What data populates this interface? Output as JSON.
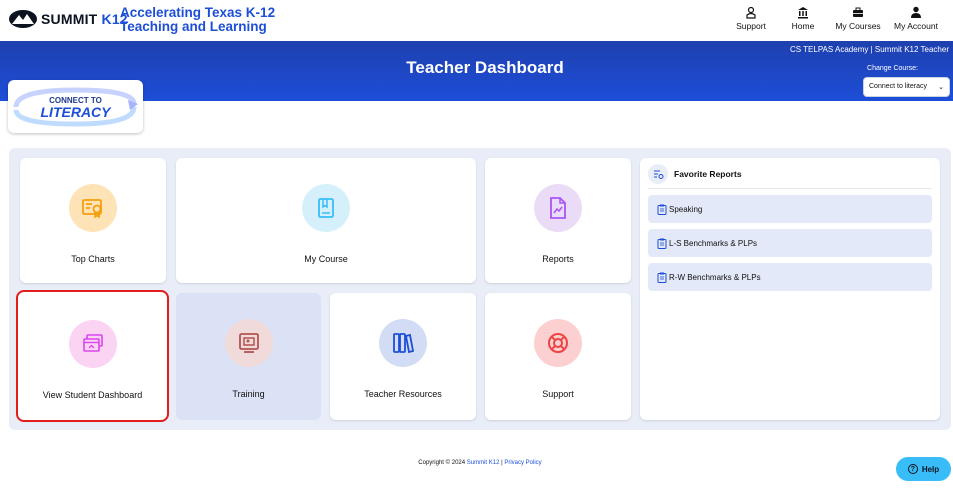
{
  "header": {
    "brand": "SUMMIT",
    "brand_k12": "K12",
    "tagline_line1": "Accelerating Texas K-12",
    "tagline_line2": "Teaching and Learning",
    "nav": [
      {
        "label": "Support",
        "icon": "support-icon"
      },
      {
        "label": "Home",
        "icon": "home-icon"
      },
      {
        "label": "My Courses",
        "icon": "briefcase-icon"
      },
      {
        "label": "My Account",
        "icon": "user-icon"
      }
    ]
  },
  "banner": {
    "title": "Teacher Dashboard",
    "school": "CS TELPAS Academy | Summit K12 Teacher",
    "change_course_label": "Change Course:",
    "selected_course": "Connect to literacy"
  },
  "course_logo": {
    "line1": "CONNECT TO",
    "line2": "LITERACY"
  },
  "cards": [
    {
      "label": "Top Charts",
      "icon": "certificate-icon",
      "color": "#fde3b5",
      "icon_color": "#f59e0b"
    },
    {
      "label": "My Course",
      "icon": "book-icon",
      "color": "#d6f0fb",
      "icon_color": "#38bdf8"
    },
    {
      "label": "Reports",
      "icon": "report-chart-icon",
      "color": "#eadcf6",
      "icon_color": "#a855f7"
    },
    {
      "label": "View Student Dashboard",
      "icon": "student-dashboard-icon",
      "color": "#fbd3f3",
      "icon_color": "#d946ef"
    },
    {
      "label": "Training",
      "icon": "training-icon",
      "color": "#f1dada",
      "icon_color": "#b45353"
    },
    {
      "label": "Teacher Resources",
      "icon": "books-icon",
      "color": "#d3dcf5",
      "icon_color": "#1d4ed8"
    },
    {
      "label": "Support",
      "icon": "lifebuoy-icon",
      "color": "#fcd0d0",
      "icon_color": "#ef4444"
    }
  ],
  "favorites": {
    "title": "Favorite Reports",
    "items": [
      "Speaking",
      "L-S Benchmarks & PLPs",
      "R-W Benchmarks & PLPs"
    ]
  },
  "footer": {
    "copyright": "Copyright © 2024",
    "company": "Summit K12",
    "sep": "|",
    "privacy": "Privacy Policy"
  },
  "help_label": "Help"
}
